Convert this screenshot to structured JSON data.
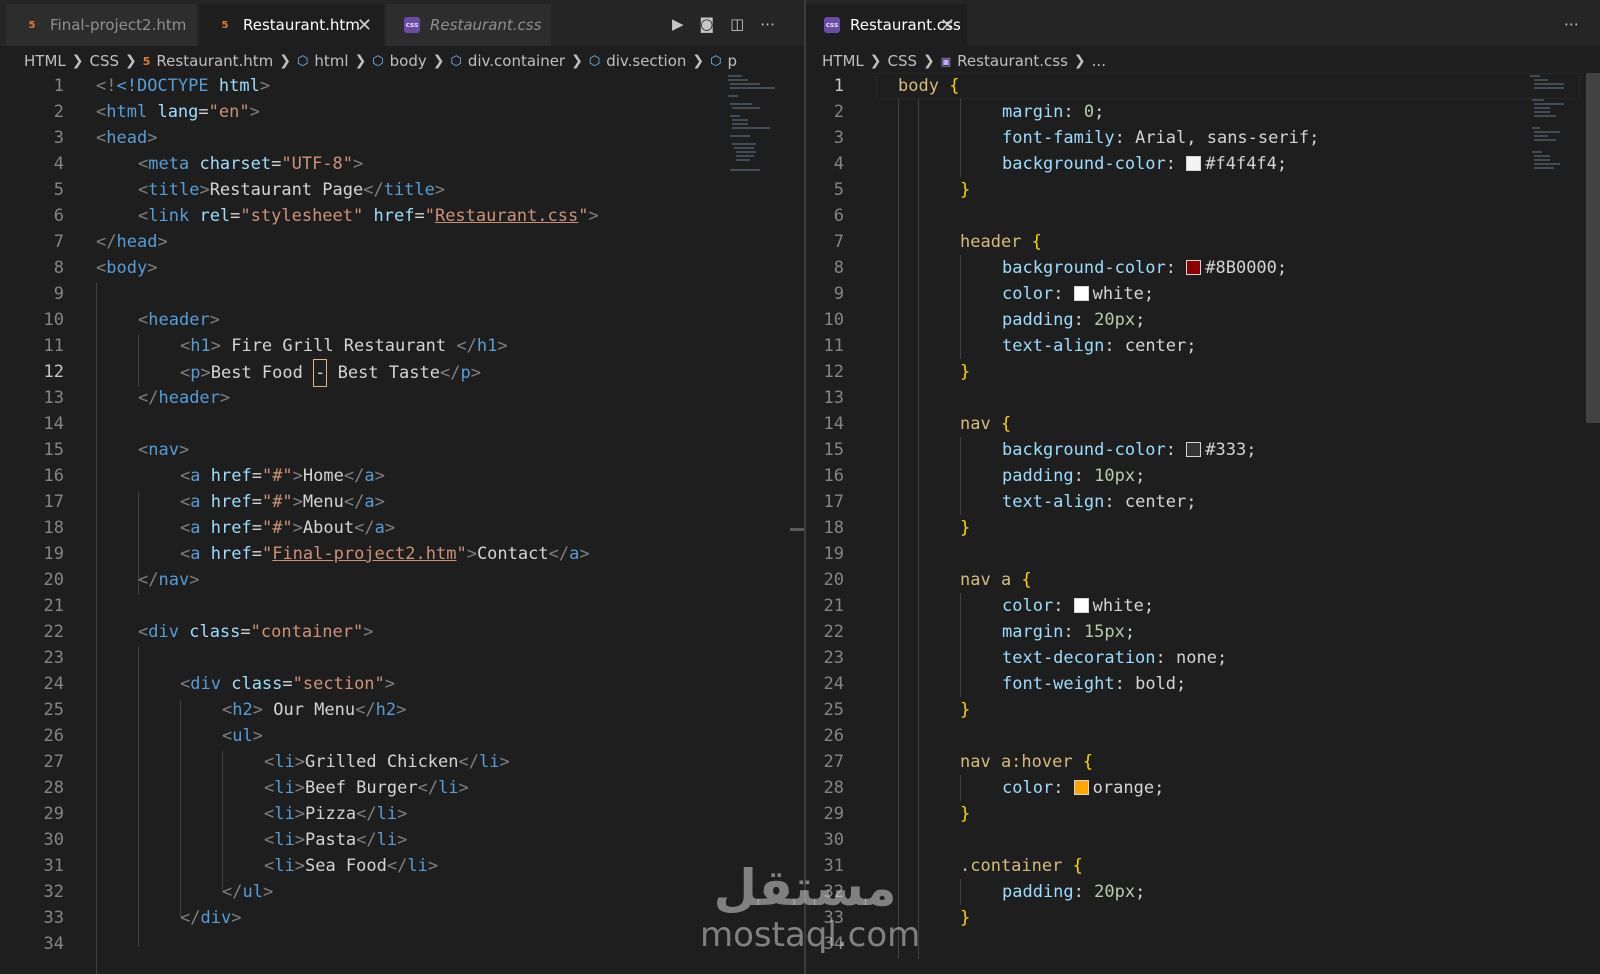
{
  "left": {
    "tabs": [
      {
        "label": "Final-project2.htm",
        "type": "html",
        "active": false,
        "italic": false
      },
      {
        "label": "Restaurant.htm",
        "type": "html",
        "active": true,
        "italic": false
      },
      {
        "label": "Restaurant.css",
        "type": "css",
        "active": false,
        "italic": true
      }
    ],
    "breadcrumb": [
      "HTML",
      "CSS",
      "Restaurant.htm",
      "html",
      "body",
      "div.container",
      "div.section",
      "p"
    ],
    "line_numbers": [
      "1",
      "2",
      "3",
      "4",
      "5",
      "6",
      "7",
      "8",
      "9",
      "10",
      "11",
      "12",
      "13",
      "14",
      "15",
      "16",
      "17",
      "18",
      "19",
      "20",
      "21",
      "22",
      "23",
      "24",
      "25",
      "26",
      "27",
      "28",
      "29",
      "30",
      "31",
      "32",
      "33",
      "34"
    ],
    "code": {
      "l1_doctype": "<!DOCTYPE",
      "l1_html": "html",
      "l2_tag": "html",
      "l2_attr": "lang",
      "l2_val": "\"en\"",
      "l3_tag": "head",
      "l4_tag": "meta",
      "l4_attr": "charset",
      "l4_val": "\"UTF-8\"",
      "l5_tag": "title",
      "l5_text": "Restaurant Page",
      "l6_tag": "link",
      "l6_attr1": "rel",
      "l6_val1": "\"stylesheet\"",
      "l6_attr2": "href",
      "l6_val2_q": "\"",
      "l6_val2": "Restaurant.css",
      "l7_tag": "head",
      "l8_tag": "body",
      "l10_tag": "header",
      "l11_tag": "h1",
      "l11_text": " Fire Grill Restaurant ",
      "l12_tag": "p",
      "l12_text1": "Best Food ",
      "l12_dash": "-",
      "l12_text2": " Best Taste",
      "l13_tag": "header",
      "l15_tag": "nav",
      "nav_tag": "a",
      "nav_attr": "href",
      "nav_hash": "\"#\"",
      "l16_text": "Home",
      "l17_text": "Menu",
      "l18_text": "About",
      "l19_q": "\"",
      "l19_val": "Final-project2.htm",
      "l19_text": "Contact",
      "l20_tag": "nav",
      "l22_tag": "div",
      "l22_attr": "class",
      "l22_val": "\"container\"",
      "l24_tag": "div",
      "l24_attr": "class",
      "l24_val": "\"section\"",
      "l25_tag": "h2",
      "l25_text": " Our Menu",
      "l26_tag": "ul",
      "li_tag": "li",
      "l27_text": "Grilled Chicken",
      "l28_text": "Beef Burger",
      "l29_text": "Pizza",
      "l30_text": "Pasta",
      "l31_text": "Sea Food",
      "l32_tag": "ul",
      "l33_tag": "div"
    }
  },
  "right": {
    "tabs": [
      {
        "label": "Restaurant.css",
        "type": "css",
        "active": true,
        "italic": false
      }
    ],
    "breadcrumb": [
      "HTML",
      "CSS",
      "Restaurant.css",
      "..."
    ],
    "line_numbers": [
      "1",
      "2",
      "3",
      "4",
      "5",
      "6",
      "7",
      "8",
      "9",
      "10",
      "11",
      "12",
      "13",
      "14",
      "15",
      "16",
      "17",
      "18",
      "19",
      "20",
      "21",
      "22",
      "23",
      "24",
      "25",
      "26",
      "27",
      "28",
      "29",
      "30",
      "31",
      "32",
      "33",
      "34"
    ],
    "code": {
      "body_sel": "body",
      "margin": "margin",
      "zero": "0",
      "font_family": "font-family",
      "font_val": "Arial, sans-serif",
      "bg": "background-color",
      "bg_body": "#f4f4f4",
      "header_sel": "header",
      "bg_header": "#8B0000",
      "color": "color",
      "white": "white",
      "padding": "padding",
      "p20": "20px",
      "text_align": "text-align",
      "center": "center",
      "nav_sel": "nav",
      "bg_nav": "#333",
      "p10": "10px",
      "nav_a_sel": "nav a",
      "m15": "15px",
      "text_deco": "text-decoration",
      "none": "none",
      "font_weight": "font-weight",
      "bold": "bold",
      "nav_hover_sel": "nav a:hover",
      "orange": "orange",
      "container_sel": ".container"
    },
    "colors": {
      "body_bg": "#f4f4f4",
      "header_bg": "#8B0000",
      "white": "#ffffff",
      "nav_bg": "#333333",
      "orange": "#ffa500"
    }
  },
  "watermark": {
    "arabic": "مستقل",
    "latin": "mostaql.com"
  }
}
